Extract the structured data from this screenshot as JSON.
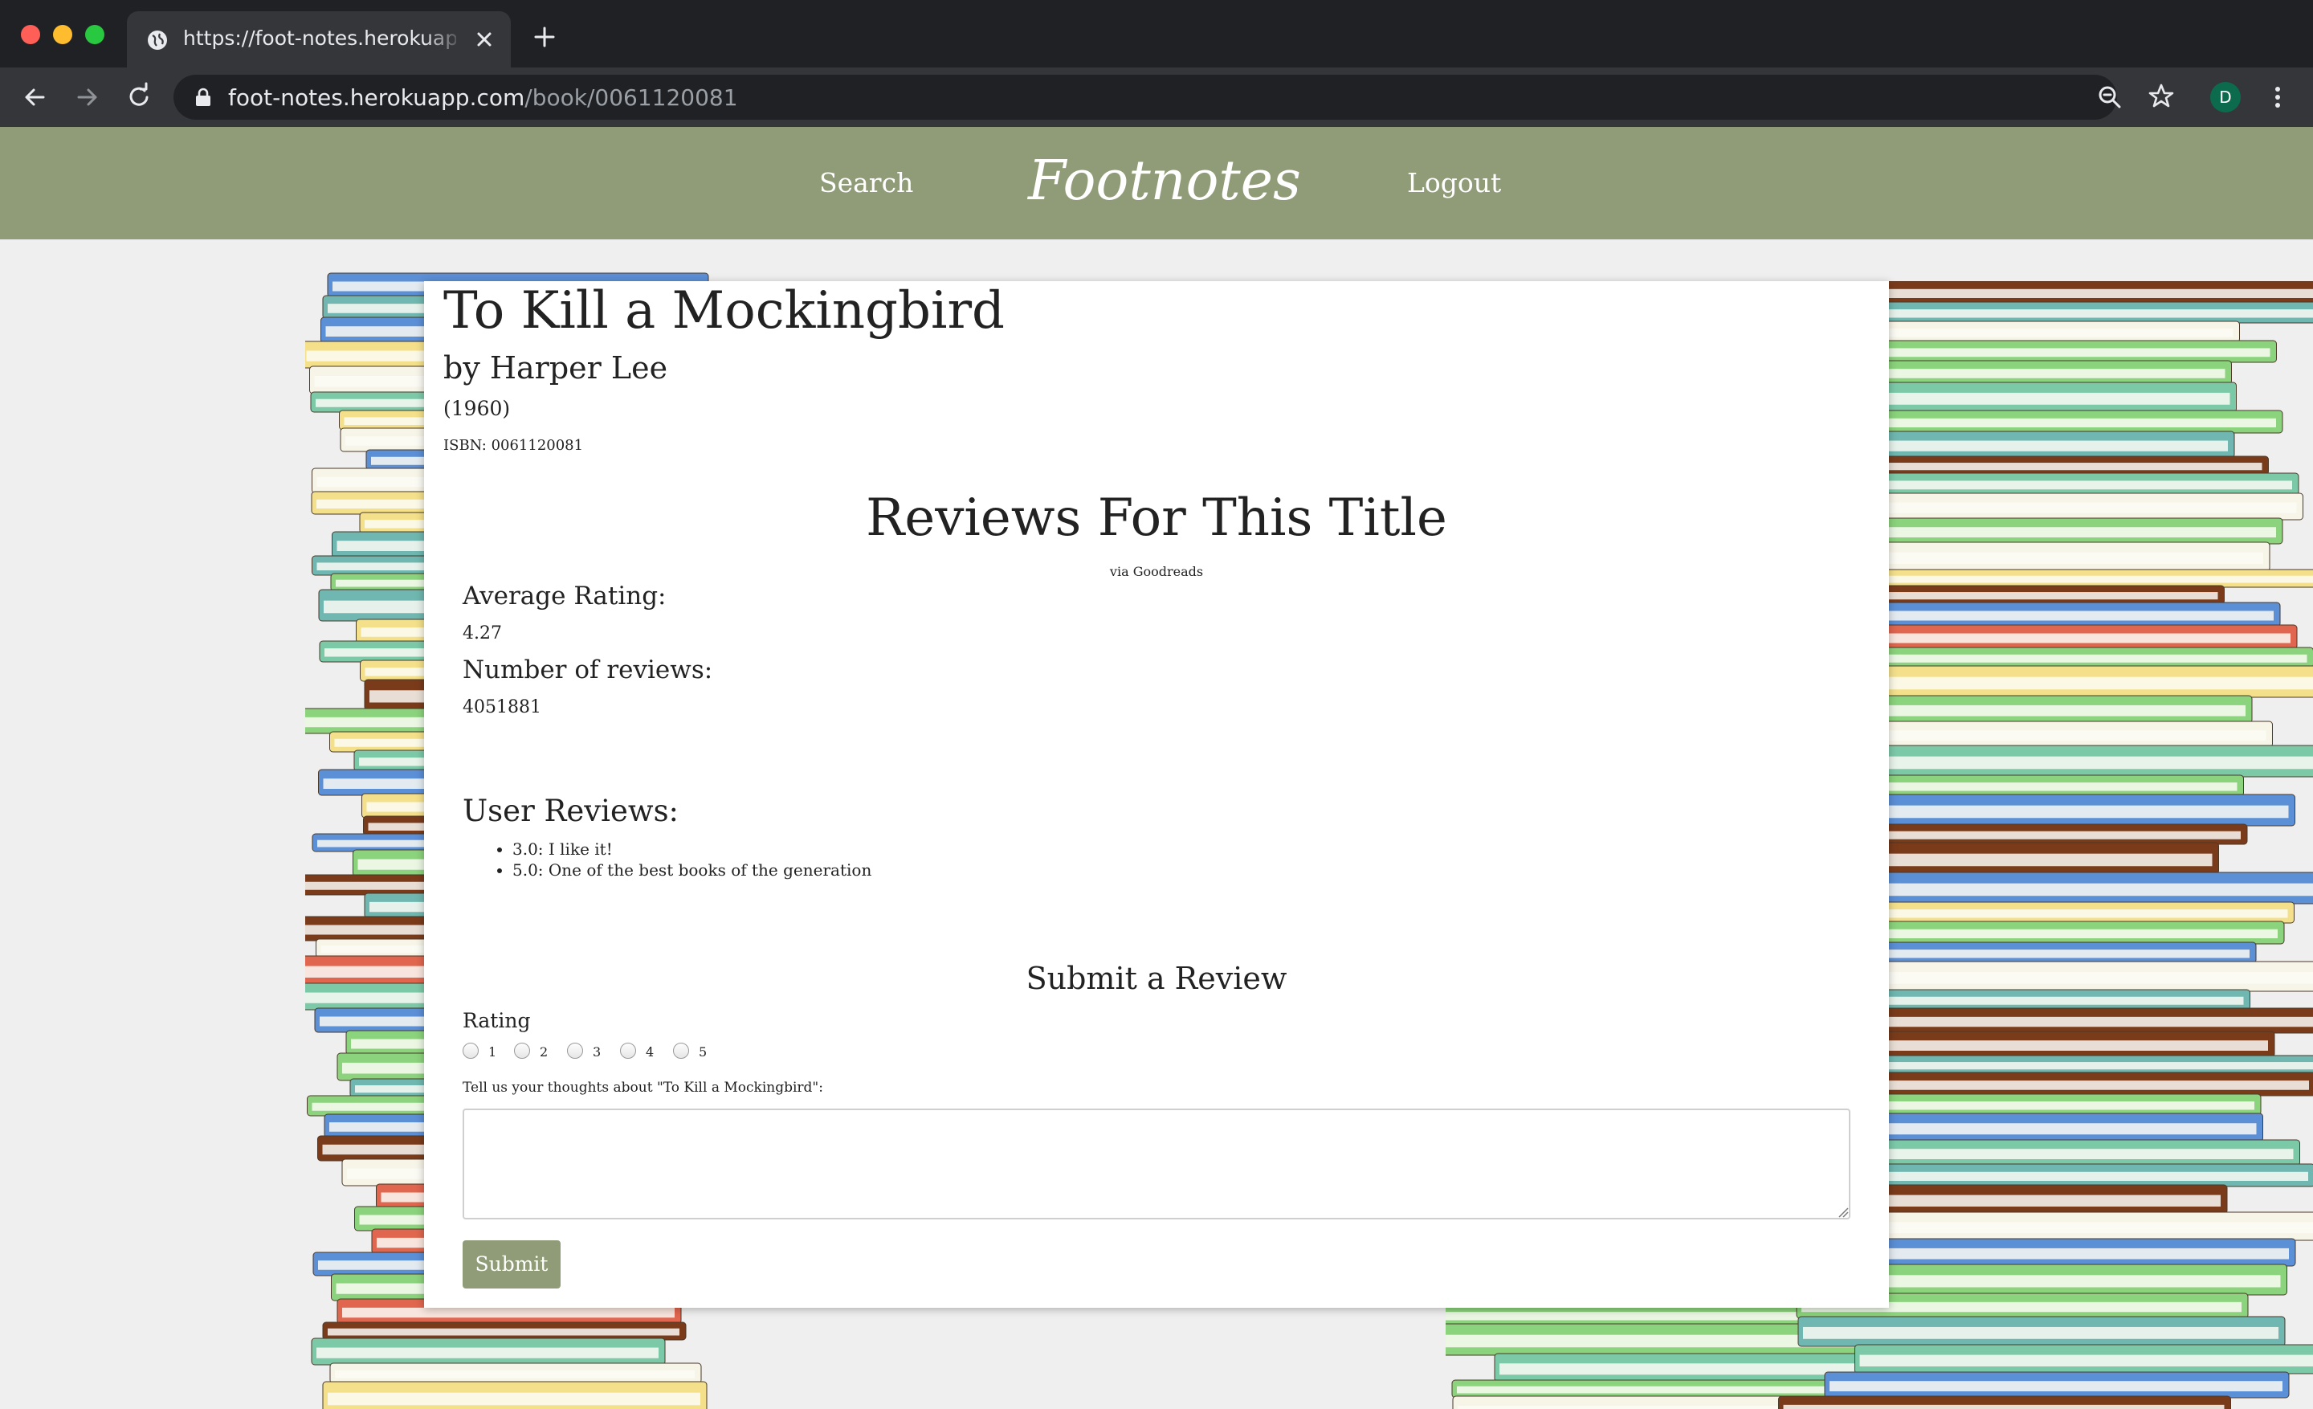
{
  "browser": {
    "tab_title": "https://foot-notes.herokuapp.com",
    "url_host": "foot-notes.herokuapp.com",
    "url_path": "/book/0061120081",
    "profile_initial": "D"
  },
  "site": {
    "nav_search": "Search",
    "logo": "Footnotes",
    "nav_logout": "Logout",
    "colors": {
      "header": "#909c78",
      "page_bg": "#efefef"
    }
  },
  "book": {
    "title": "To Kill a Mockingbird",
    "author": "by Harper Lee",
    "year": "(1960)",
    "isbn": "ISBN: 0061120081"
  },
  "reviews": {
    "heading": "Reviews For This Title",
    "source": "via Goodreads",
    "average_label": "Average Rating:",
    "average_value": "4.27",
    "count_label": "Number of reviews:",
    "count_value": "4051881",
    "user_reviews_label": "User Reviews:",
    "user_reviews": [
      {
        "rating": "3.0:",
        "text": "I like it!"
      },
      {
        "rating": "5.0:",
        "text": "One of the best books of the generation"
      }
    ]
  },
  "form": {
    "heading": "Submit a Review",
    "rating_label": "Rating",
    "rating_options": [
      "1",
      "2",
      "3",
      "4",
      "5"
    ],
    "thoughts_label": "Tell us your thoughts about \"To Kill a Mockingbird\":",
    "thoughts_value": "",
    "submit_label": "Submit"
  }
}
